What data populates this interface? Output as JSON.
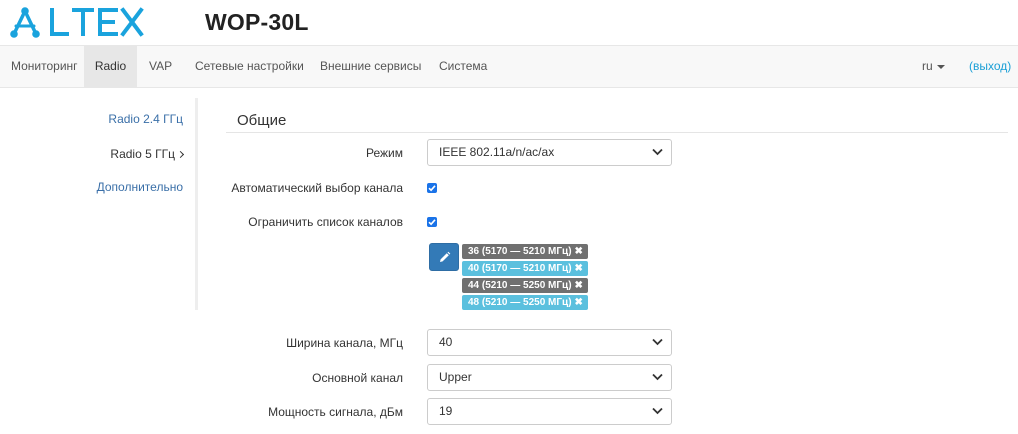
{
  "brand": {
    "logo_text": "ELTEX",
    "product": "WOP-30L",
    "logo_color": "#1aa3dd"
  },
  "nav": {
    "items": [
      "Мониторинг",
      "Radio",
      "VAP",
      "Сетевые настройки",
      "Внешние сервисы",
      "Система"
    ],
    "active": "Radio",
    "lang": "ru",
    "logout": "(выход)"
  },
  "sidebar": {
    "items": [
      "Radio 2.4 ГГц",
      "Radio 5 ГГц",
      "Дополнительно"
    ],
    "current": "Radio 5 ГГц"
  },
  "section": {
    "title": "Общие"
  },
  "form": {
    "mode": {
      "label": "Режим",
      "value": "IEEE 802.11a/n/ac/ax"
    },
    "auto_channel": {
      "label": "Автоматический выбор канала",
      "checked": true
    },
    "limit_channels": {
      "label": "Ограничить список каналов",
      "checked": true
    },
    "channel_tags": [
      {
        "text": "36 (5170 — 5210 МГц)",
        "style": "dark"
      },
      {
        "text": "40 (5170 — 5210 МГц)",
        "style": "light"
      },
      {
        "text": "44 (5210 — 5250 МГц)",
        "style": "dark"
      },
      {
        "text": "48 (5210 — 5250 МГц)",
        "style": "light"
      }
    ],
    "tag_remove_glyph": "✖",
    "width": {
      "label": "Ширина канала, МГц",
      "value": "40"
    },
    "primary_channel": {
      "label": "Основной канал",
      "value": "Upper"
    },
    "power": {
      "label": "Мощность сигнала, дБм",
      "value": "19"
    }
  },
  "colors": {
    "accent": "#337ab7",
    "link": "#1a9fd6",
    "tag_dark": "#707070",
    "tag_light": "#5bc0de",
    "checkbox": "#1a73e8"
  }
}
